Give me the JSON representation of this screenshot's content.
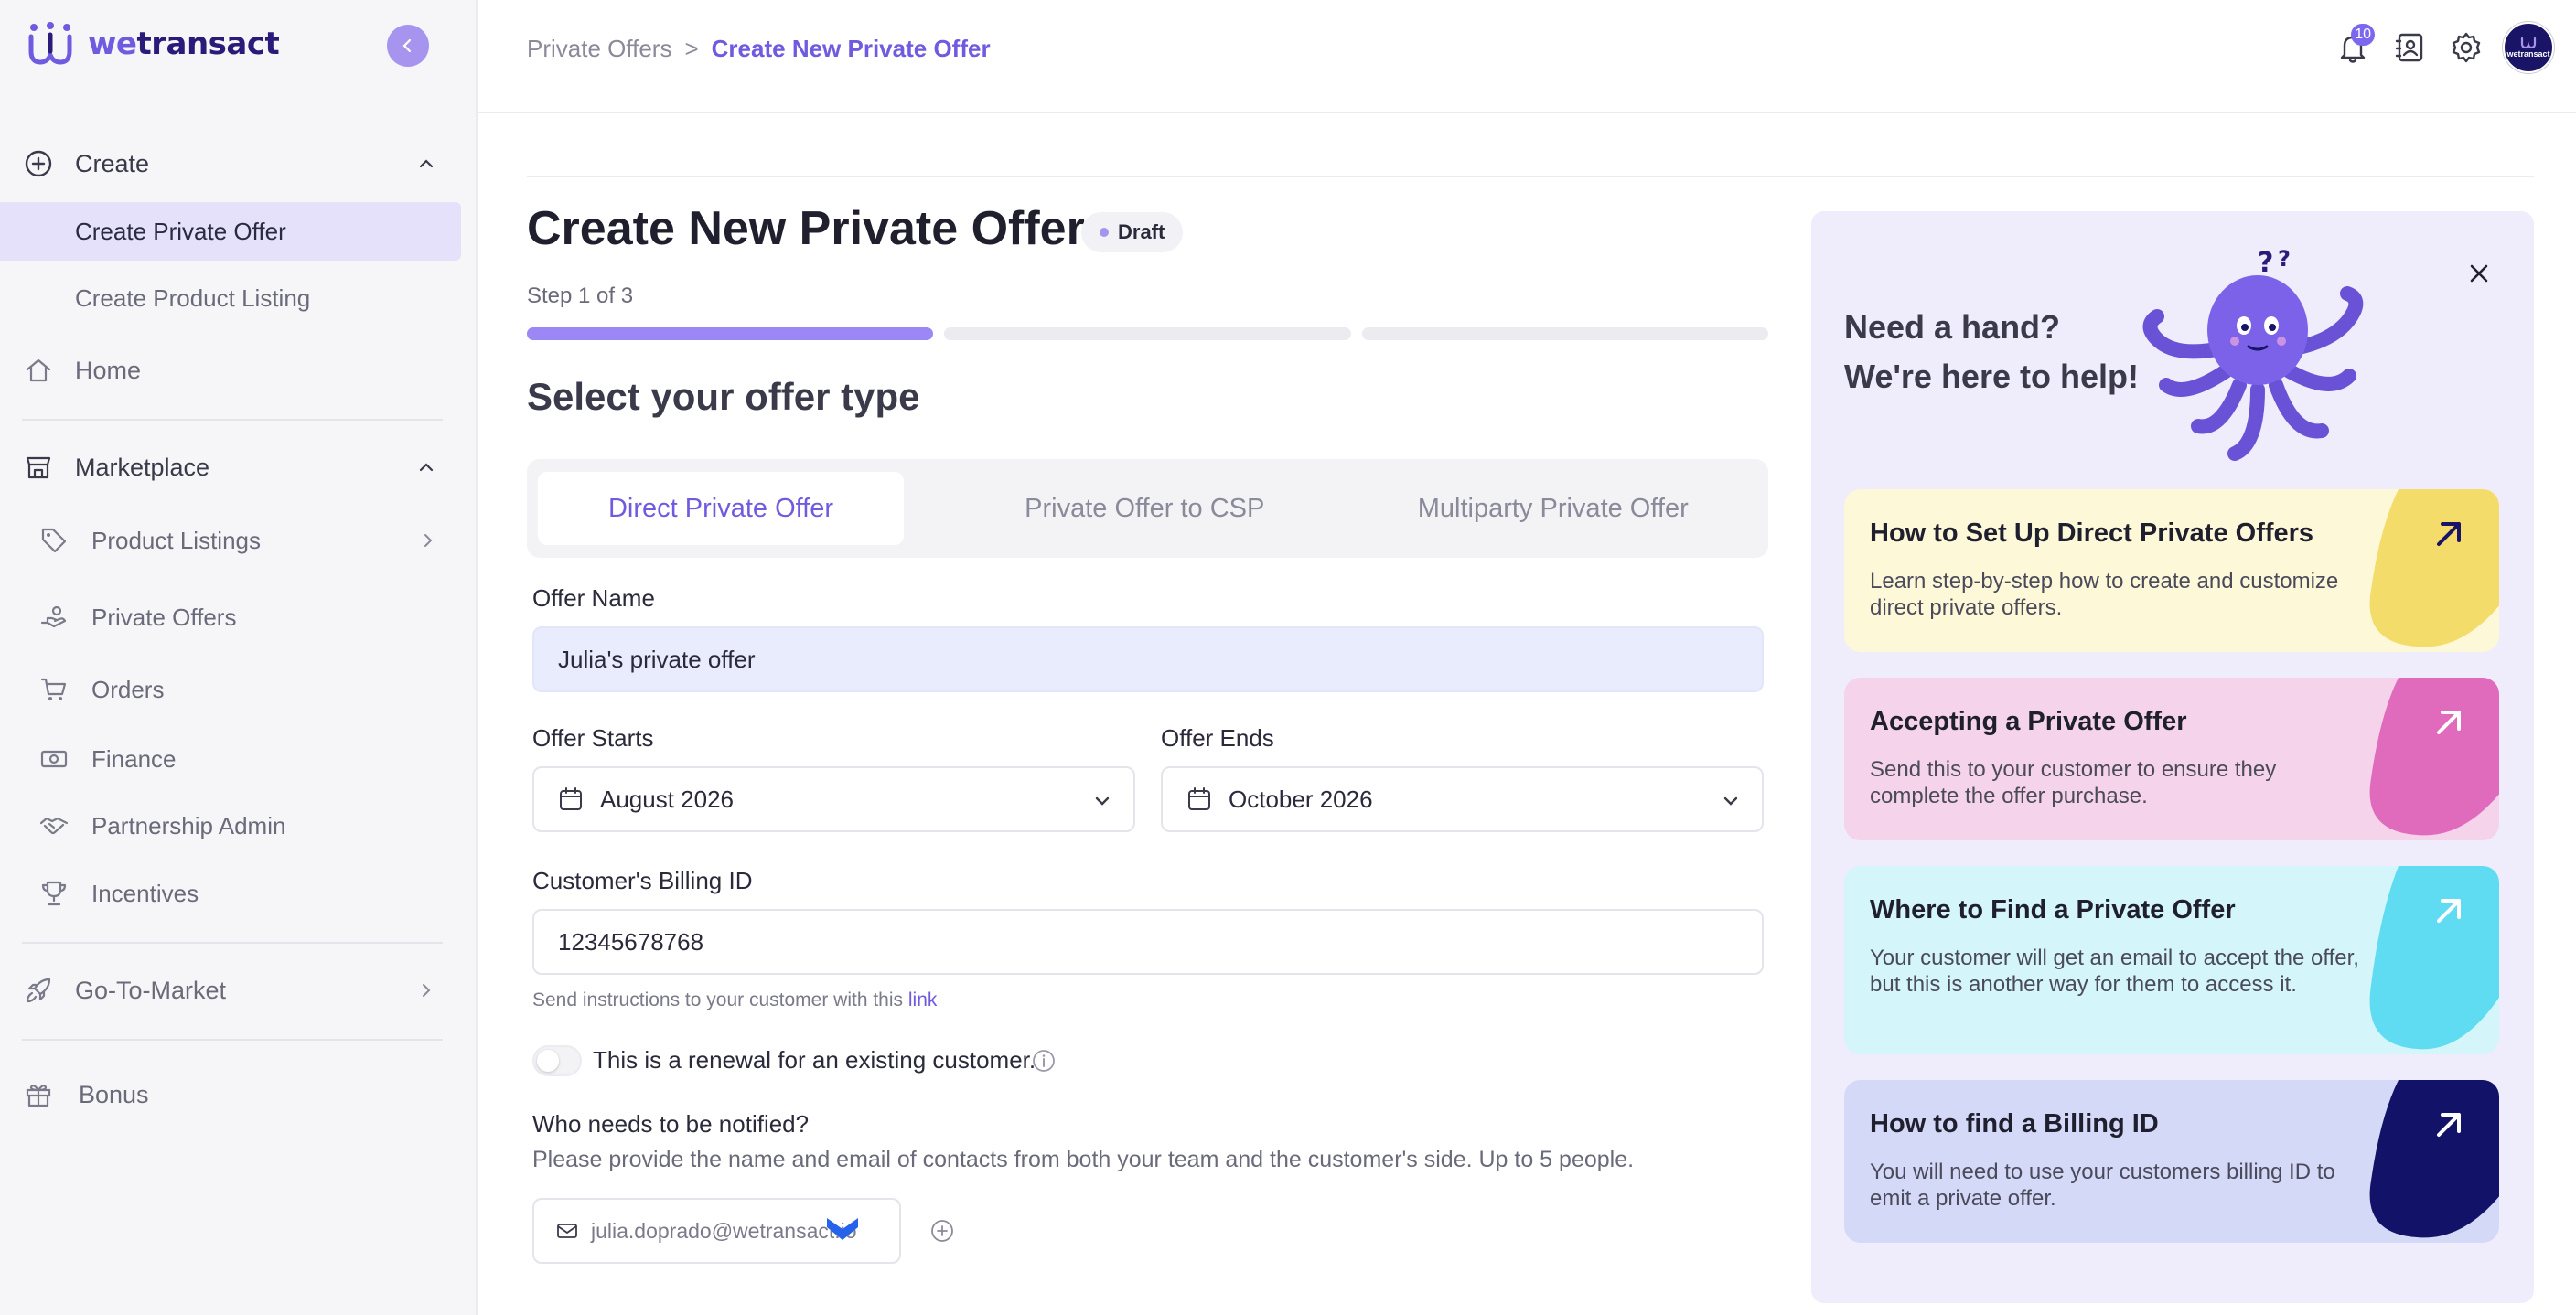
{
  "brand": {
    "name_prefix": "we",
    "name_suffix": "transact",
    "accent": "#6f5be0",
    "dark": "#1a1466"
  },
  "sidebar": {
    "create_section": {
      "label": "Create",
      "icon": "plus-circle-icon"
    },
    "create_items": [
      {
        "label": "Create Private Offer",
        "active": true
      },
      {
        "label": "Create Product Listing",
        "active": false
      }
    ],
    "home": {
      "label": "Home",
      "icon": "home-icon"
    },
    "marketplace_section": {
      "label": "Marketplace",
      "icon": "store-icon"
    },
    "marketplace_items": [
      {
        "label": "Product Listings",
        "icon": "tag-icon"
      },
      {
        "label": "Private Offers",
        "icon": "hand-offer-icon"
      },
      {
        "label": "Orders",
        "icon": "cart-icon"
      },
      {
        "label": "Finance",
        "icon": "banknote-icon"
      },
      {
        "label": "Partnership Admin",
        "icon": "handshake-icon"
      },
      {
        "label": "Incentives",
        "icon": "trophy-icon"
      }
    ],
    "go_to_market": {
      "label": "Go-To-Market",
      "icon": "rocket-icon"
    },
    "bonus": {
      "label": "Bonus",
      "icon": "gift-icon"
    }
  },
  "topbar": {
    "breadcrumb": {
      "parent": "Private Offers",
      "separator": ">",
      "current": "Create New Private Offer"
    },
    "notification_count": "10",
    "avatar_text": "wetransact"
  },
  "main": {
    "title": "Create New Private Offer",
    "status_badge": "Draft",
    "step_text": "Step 1 of 3",
    "progress": {
      "current_step": 1,
      "total_steps": 3
    },
    "section_title": "Select your offer type",
    "tabs": [
      {
        "label": "Direct Private Offer",
        "active": true
      },
      {
        "label": "Private Offer to CSP",
        "active": false
      },
      {
        "label": "Multiparty Private Offer",
        "active": false
      }
    ],
    "offer_name": {
      "label": "Offer Name",
      "value": "Julia's private offer"
    },
    "offer_starts": {
      "label": "Offer Starts",
      "value": "August 2026"
    },
    "offer_ends": {
      "label": "Offer Ends",
      "value": "October 2026"
    },
    "billing_id": {
      "label": "Customer's Billing ID",
      "value": "12345678768"
    },
    "helper_text": "Send instructions to your customer with this",
    "helper_link": "link",
    "renewal_label": "This is a renewal for an existing customer.",
    "notify_title": "Who needs to be notified?",
    "notify_desc": "Please provide the name and email of contacts from both your team and the customer's side. Up to 5 people.",
    "contact_email": "julia.doprado@wetransact.io"
  },
  "help": {
    "title_line1": "Need a hand?",
    "title_line2": "We're here to help!",
    "cards": [
      {
        "title": "How to Set Up Direct Private Offers",
        "desc": "Learn step-by-step how to create and customize direct private offers.",
        "bg": "#fdf8d8",
        "blob": "#f3dc6a",
        "arrow": "#1a1466"
      },
      {
        "title": "Accepting a Private Offer",
        "desc": "Send this to your customer to ensure they complete the offer purchase.",
        "bg": "#f5d3ea",
        "blob": "#e06bbd",
        "arrow": "#ffffff"
      },
      {
        "title": "Where to Find a Private Offer",
        "desc": "Your customer will get an email to accept the offer, but this is another way for them to access it.",
        "bg": "#d4f5f9",
        "blob": "#5fdcf2",
        "arrow": "#ffffff"
      },
      {
        "title": "How to find a Billing ID",
        "desc": "You will need to use your customers billing ID to emit a private offer.",
        "bg": "#d5d9f8",
        "blob": "#121269",
        "arrow": "#ffffff"
      }
    ]
  }
}
